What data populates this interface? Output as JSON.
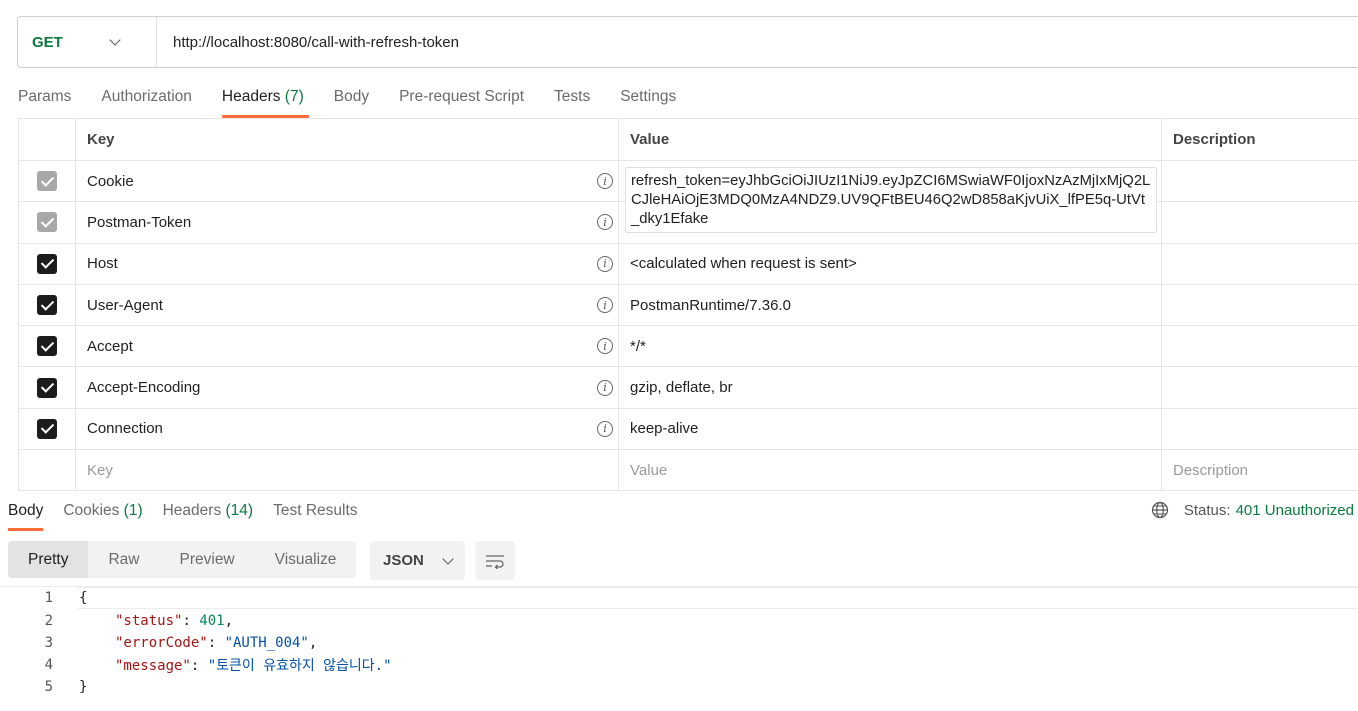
{
  "request": {
    "method": "GET",
    "url": "http://localhost:8080/call-with-refresh-token"
  },
  "request_tabs": [
    {
      "label": "Params",
      "count": ""
    },
    {
      "label": "Authorization",
      "count": ""
    },
    {
      "label": "Headers",
      "count": "(7)"
    },
    {
      "label": "Body",
      "count": ""
    },
    {
      "label": "Pre-request Script",
      "count": ""
    },
    {
      "label": "Tests",
      "count": ""
    },
    {
      "label": "Settings",
      "count": ""
    }
  ],
  "headers_table": {
    "columns": {
      "key": "Key",
      "value": "Value",
      "description": "Description"
    },
    "rows": [
      {
        "key": "Cookie",
        "value": "refresh_token=eyJhbGciOiJIUzI1NiJ9.eyJpZCI6MSwiaWF0IjoxNzAzMjIxMjQ2LCJleHAiOjE3MDQ0MzA4NDZ9.UV9QFtBEU46Q2wD858aKjvUiX_lfPE5q-UtVt_dky1Efake",
        "checked": true,
        "locked": true
      },
      {
        "key": "Postman-Token",
        "value": "",
        "checked": true,
        "locked": true
      },
      {
        "key": "Host",
        "value": "<calculated when request is sent>",
        "checked": true,
        "locked": false
      },
      {
        "key": "User-Agent",
        "value": "PostmanRuntime/7.36.0",
        "checked": true,
        "locked": false
      },
      {
        "key": "Accept",
        "value": "*/*",
        "checked": true,
        "locked": false
      },
      {
        "key": "Accept-Encoding",
        "value": "gzip, deflate, br",
        "checked": true,
        "locked": false
      },
      {
        "key": "Connection",
        "value": "keep-alive",
        "checked": true,
        "locked": false
      }
    ],
    "placeholder": {
      "key": "Key",
      "value": "Value",
      "description": "Description"
    }
  },
  "response_tabs": [
    {
      "label": "Body",
      "count": ""
    },
    {
      "label": "Cookies",
      "count": "(1)"
    },
    {
      "label": "Headers",
      "count": "(14)"
    },
    {
      "label": "Test Results",
      "count": ""
    }
  ],
  "status": {
    "label": "Status:",
    "value": "401 Unauthorized"
  },
  "view_modes": [
    "Pretty",
    "Raw",
    "Preview",
    "Visualize"
  ],
  "format": "JSON",
  "response_body": {
    "line_numbers": [
      "1",
      "2",
      "3",
      "4",
      "5"
    ],
    "open_brace": "{",
    "close_brace": "}",
    "status_key": "\"status\"",
    "status_value": "401",
    "error_key": "\"errorCode\"",
    "error_value": "\"AUTH_004\"",
    "message_key": "\"message\"",
    "message_value": "\"토큰이 유효하지 않습니다.\""
  },
  "colors": {
    "accent": "#ff6c37",
    "success": "#0a7a3f"
  }
}
